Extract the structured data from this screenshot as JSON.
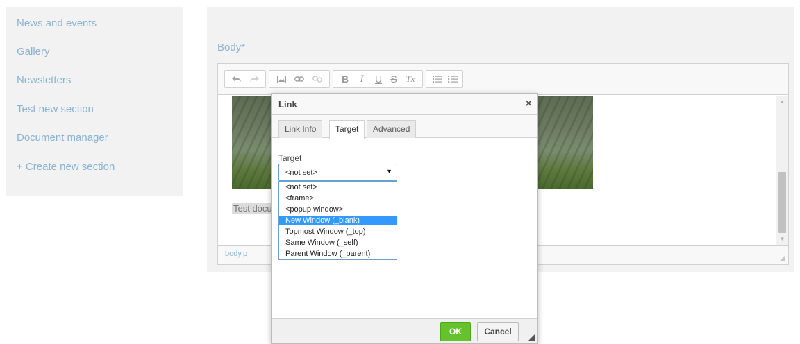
{
  "sidebar": {
    "items": [
      {
        "label": "News and events"
      },
      {
        "label": "Gallery"
      },
      {
        "label": "Newsletters"
      },
      {
        "label": "Test new section"
      },
      {
        "label": "Document manager"
      },
      {
        "label": "+ Create new section"
      }
    ]
  },
  "main": {
    "body_label": "Body*"
  },
  "toolbar": {
    "buttons": [
      {
        "icon": "undo-icon"
      },
      {
        "icon": "redo-icon"
      },
      {
        "icon": "image-icon"
      },
      {
        "icon": "link-icon"
      },
      {
        "icon": "unlink-icon"
      },
      {
        "icon": "bold-icon",
        "glyph": "B"
      },
      {
        "icon": "italic-icon",
        "glyph": "I"
      },
      {
        "icon": "underline-icon",
        "glyph": "U"
      },
      {
        "icon": "strikethrough-icon",
        "glyph": "S"
      },
      {
        "icon": "remove-format-icon",
        "glyph": "Tx"
      },
      {
        "icon": "numbered-list-icon"
      },
      {
        "icon": "bulleted-list-icon"
      }
    ]
  },
  "editor": {
    "content_text": "Test docu",
    "path": [
      "body",
      "p"
    ]
  },
  "dialog": {
    "title": "Link",
    "close_glyph": "×",
    "tabs": [
      {
        "label": "Link Info"
      },
      {
        "label": "Target"
      },
      {
        "label": "Advanced"
      }
    ],
    "active_tab": "Target",
    "target_label": "Target",
    "target_selected": "<not set>",
    "target_options": [
      "<not set>",
      "<frame>",
      "<popup window>",
      "New Window (_blank)",
      "Topmost Window (_top)",
      "Same Window (_self)",
      "Parent Window (_parent)"
    ],
    "highlighted_option": "New Window (_blank)",
    "ok_label": "OK",
    "cancel_label": "Cancel"
  },
  "colors": {
    "link_accent": "#8ab3d3",
    "ok_green": "#65c12c",
    "option_highlight": "#3399ff"
  }
}
